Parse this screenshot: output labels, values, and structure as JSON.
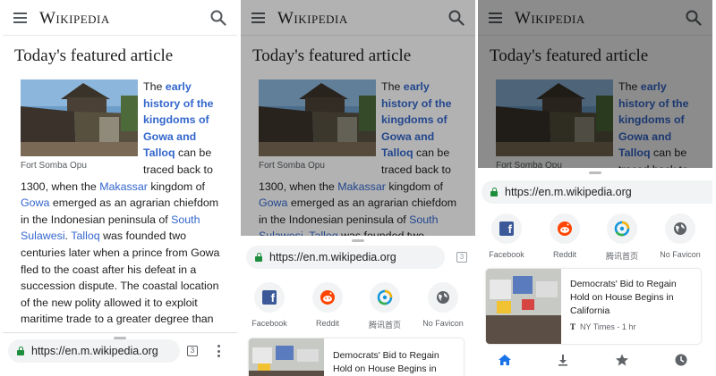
{
  "wikipedia": {
    "wordmark": "Wikipedia",
    "featured_heading": "Today's featured article",
    "image_caption": "Fort Somba Opu",
    "paragraph": {
      "the": "The ",
      "link_early_history": "early history of the kingdoms of Gowa and Talloq",
      "can_be": " can be traced back to 1300, when the ",
      "link_makassar": "Makassar",
      "kingdom_of": " kingdom of ",
      "link_gowa": "Gowa",
      "emerged": " emerged as an agrarian chiefdom in the Indonesian peninsula of ",
      "link_south_sulawesi": "South Sulawesi",
      "period": ". ",
      "link_talloq": "Talloq",
      "founded": " was founded two centuries later when a prince from Gowa fled to the coast after his defeat in a succession dispute. The coastal location of the new polity allowed it to exploit maritime trade to a greater degree than"
    }
  },
  "browser": {
    "url": "https://en.m.wikipedia.org",
    "tab_count": "3",
    "shortcuts": [
      {
        "label": "Facebook",
        "icon": "facebook-icon"
      },
      {
        "label": "Reddit",
        "icon": "reddit-icon"
      },
      {
        "label": "腾讯首页",
        "icon": "tencent-icon"
      },
      {
        "label": "No Favicon",
        "icon": "globe-icon"
      }
    ],
    "news_card": {
      "title": "Democrats' Bid to Regain Hold on House Begins in California",
      "source_logo": "T",
      "source": "NY Times - 1 hr"
    },
    "nav_icons": [
      "home-icon",
      "download-icon",
      "star-icon",
      "history-icon"
    ]
  },
  "colors": {
    "link": "#3366cc",
    "lock_green": "#1e8e3e",
    "home_blue": "#1a73e8",
    "facebook": "#3b5998",
    "reddit": "#ff4500"
  }
}
